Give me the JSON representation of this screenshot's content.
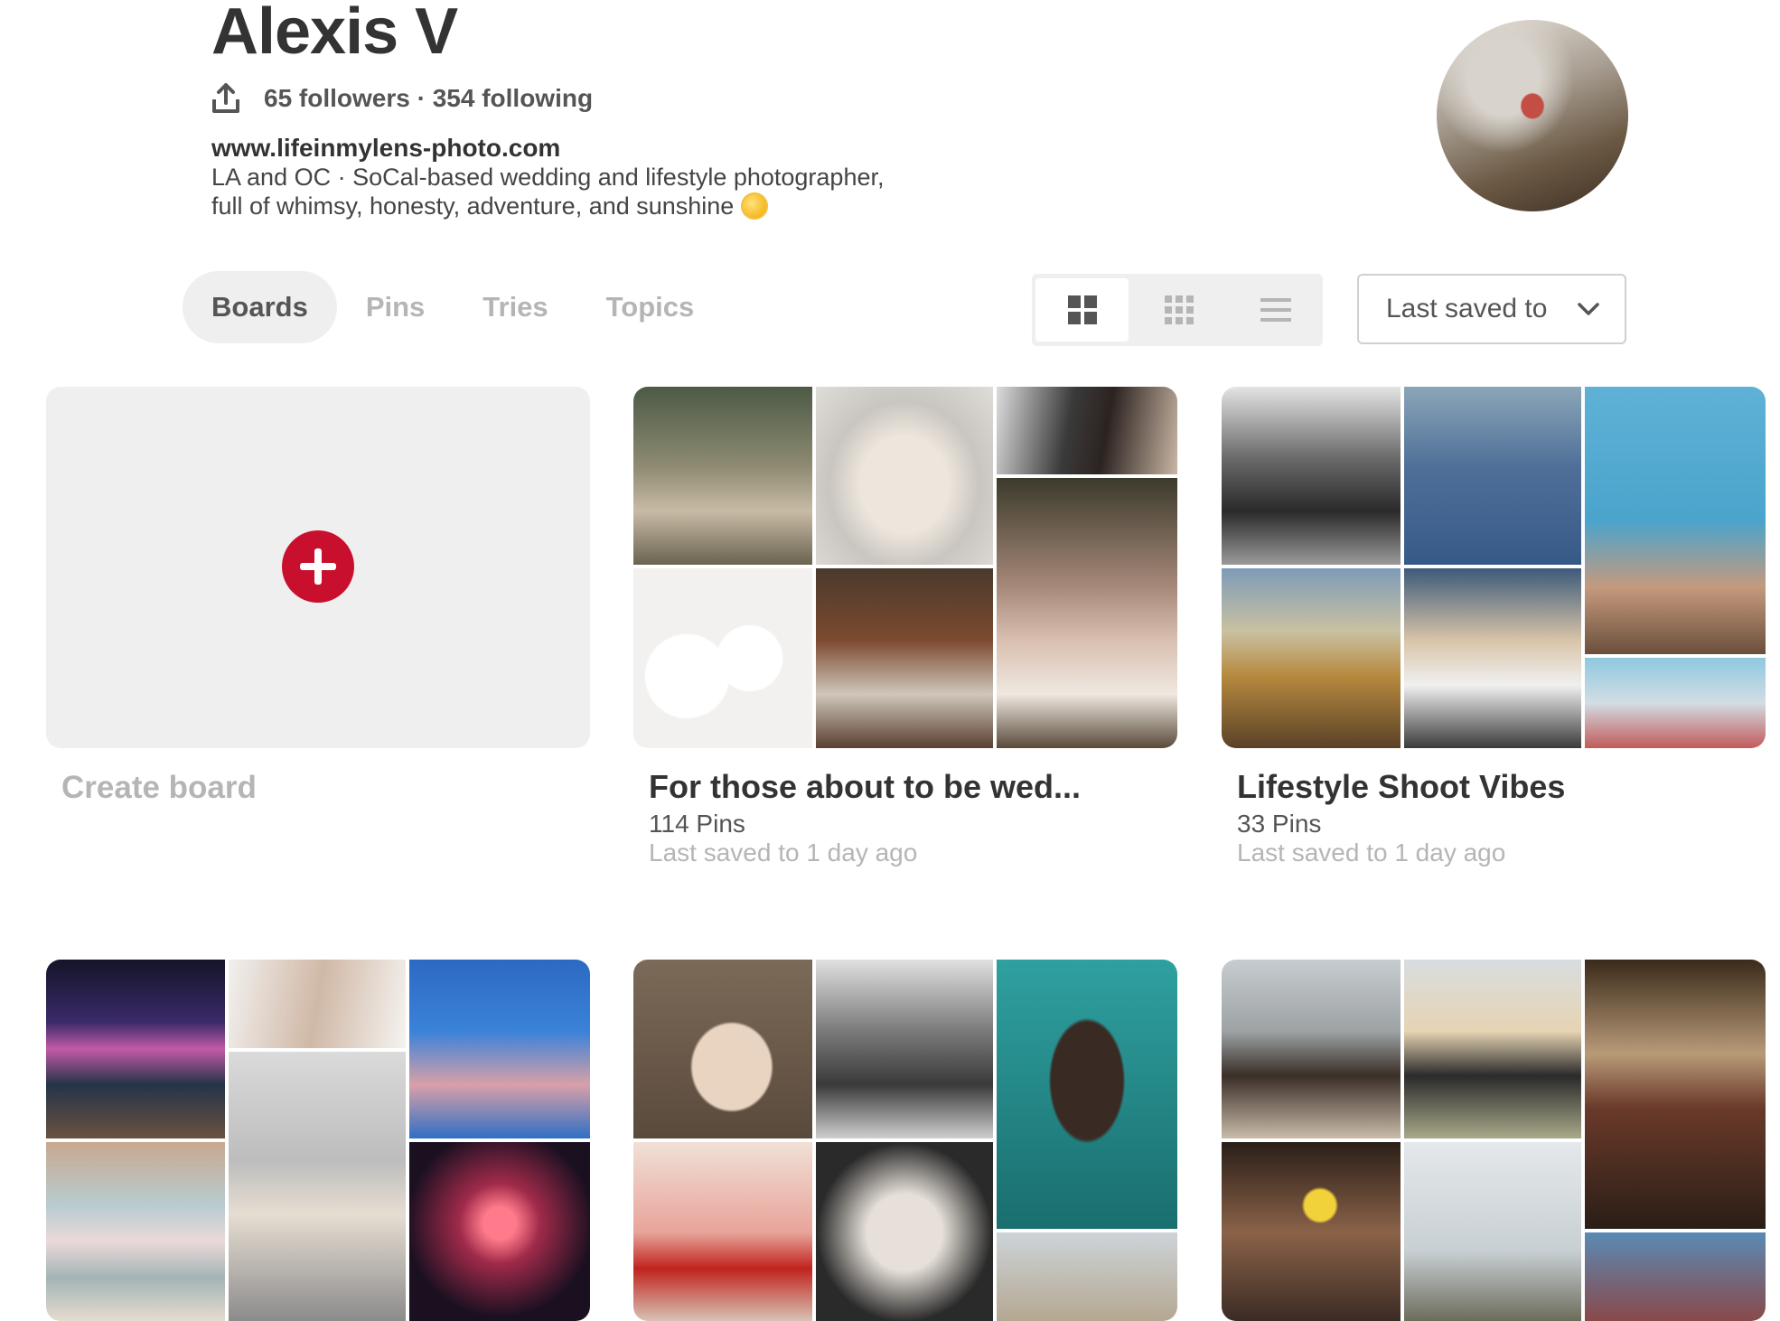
{
  "profile": {
    "name": "Alexis V",
    "followers": "65 followers · 354 following",
    "website": "www.lifeinmylens-photo.com",
    "bio_line1": "LA and OC  ·  SoCal-based wedding and lifestyle photographer,",
    "bio_line2": "full of whimsy, honesty, adventure, and sunshine"
  },
  "tabs": [
    "Boards",
    "Pins",
    "Tries",
    "Topics"
  ],
  "active_tab": "Boards",
  "view_modes": [
    "grid-large-icon",
    "grid-small-icon",
    "list-icon"
  ],
  "sort": {
    "label": "Last saved to"
  },
  "create_board": {
    "label": "Create board"
  },
  "boards": [
    {
      "title": "For those about to be wed...",
      "pins": "114 Pins",
      "updated": "Last saved to 1 day ago"
    },
    {
      "title": "Lifestyle Shoot Vibes",
      "pins": "33 Pins",
      "updated": "Last saved to 1 day ago"
    }
  ],
  "colors": {
    "accent": "#c8102e",
    "muted": "#b5b5b5",
    "surface": "#efefef"
  }
}
